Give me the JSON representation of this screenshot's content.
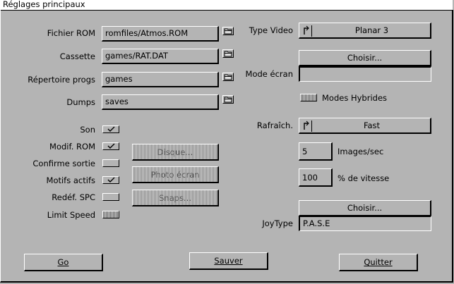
{
  "window": {
    "title": "Réglages principaux"
  },
  "left": {
    "rom_label": "Fichier ROM",
    "rom_value": "romfiles/Atmos.ROM",
    "cassette_label": "Cassette",
    "cassette_value": "games/RAT.DAT",
    "progs_label": "Répertoire progs",
    "progs_value": "games",
    "dumps_label": "Dumps",
    "dumps_value": "saves"
  },
  "options": {
    "son": {
      "label": "Son",
      "checked": true
    },
    "modif_rom": {
      "label": "Modif. ROM",
      "checked": true
    },
    "confirme_sortie": {
      "label": "Confirme sortie",
      "checked": false
    },
    "motifs_actifs": {
      "label": "Motifs actifs",
      "checked": true
    },
    "redef_spc": {
      "label": "Redéf. SPC",
      "checked": false
    },
    "limit_speed": {
      "label": "Limit Speed",
      "checked": false,
      "disabled": true
    }
  },
  "mid_buttons": {
    "disque": "Disque...",
    "photo": "Photo écran",
    "snaps": "Snaps..."
  },
  "right": {
    "type_video_label": "Type Video",
    "type_video_value": "Planar 3",
    "choisir1": "Choisir...",
    "mode_ecran_label": "Mode écran",
    "mode_ecran_value": "",
    "modes_hybrides_label": "Modes Hybrides",
    "rafraich_label": "Rafraîch.",
    "rafraich_value": "Fast",
    "images_value": "5",
    "images_label": "Images/sec",
    "vitesse_value": "100",
    "vitesse_label": "% de vitesse",
    "choisir2": "Choisir...",
    "joytype_label": "JoyType",
    "joytype_value": "P.A.S.E"
  },
  "footer": {
    "go": "Go",
    "sauver": "Sauver",
    "quitter": "Quitter"
  }
}
